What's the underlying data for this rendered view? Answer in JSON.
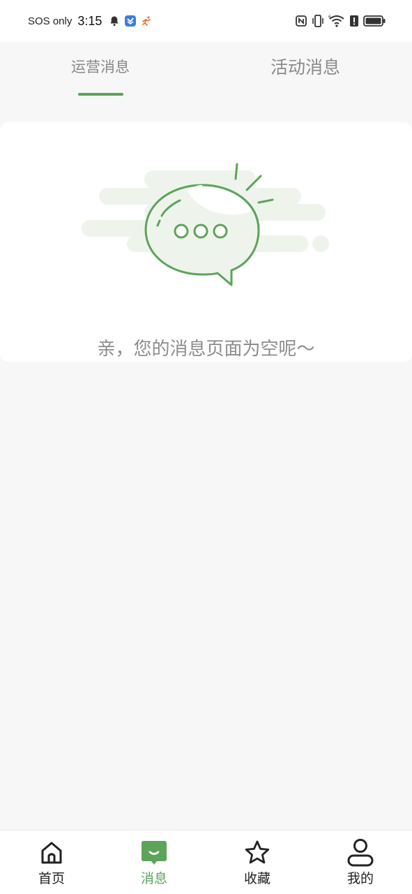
{
  "status_bar": {
    "carrier": "SOS only",
    "time": "3:15",
    "left_icons": [
      "bell-icon",
      "app-shield-icon",
      "app-runner-icon"
    ],
    "right_icons": [
      "nfc-icon",
      "vibrate-icon",
      "wifi-icon",
      "alert-icon",
      "battery-icon"
    ],
    "wifi_sub": "6"
  },
  "tabs": [
    {
      "label": "运营消息",
      "active": true
    },
    {
      "label": "活动消息",
      "active": false
    }
  ],
  "empty_state": {
    "icon": "chat-bubble-icon",
    "message": "亲，您的消息页面为空呢～"
  },
  "bottom_nav": [
    {
      "label": "首页",
      "icon": "home-icon",
      "active": false
    },
    {
      "label": "消息",
      "icon": "message-icon",
      "active": true
    },
    {
      "label": "收藏",
      "icon": "star-icon",
      "active": false
    },
    {
      "label": "我的",
      "icon": "profile-icon",
      "active": false
    }
  ],
  "colors": {
    "accent": "#5da35a",
    "background": "#f7f7f7",
    "card": "#ffffff",
    "text_muted": "#8c8c8c"
  }
}
